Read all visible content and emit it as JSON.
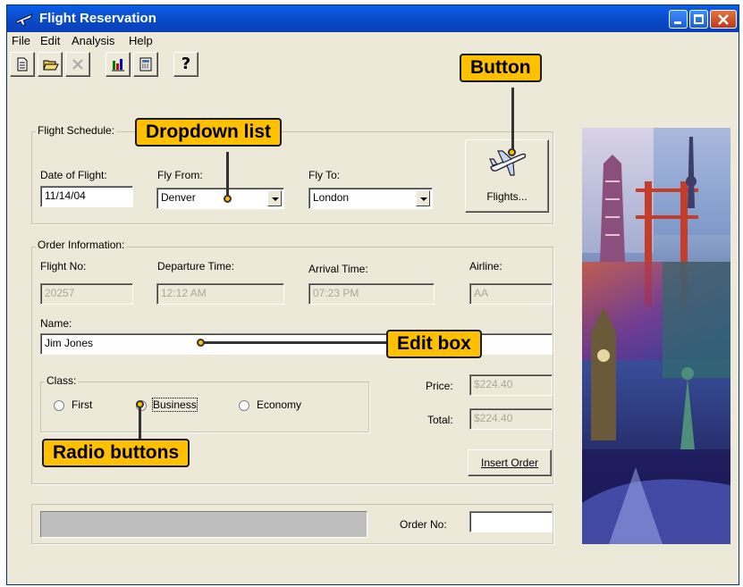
{
  "window": {
    "title": "Flight Reservation"
  },
  "menu": [
    "File",
    "Edit",
    "Analysis",
    "Help"
  ],
  "toolbar": {
    "buttons": [
      {
        "icon": "new-document-icon"
      },
      {
        "icon": "open-folder-icon"
      },
      {
        "icon": "delete-x-icon"
      },
      {
        "icon": "bar-chart-icon"
      },
      {
        "icon": "calculator-icon"
      },
      {
        "icon": "help-question-icon",
        "label": "?"
      }
    ]
  },
  "schedule": {
    "group_label": "Flight Schedule:",
    "date_label": "Date of Flight:",
    "date_value": "11/14/04",
    "from_label": "Fly From:",
    "from_value": "Denver",
    "to_label": "Fly To:",
    "to_value": "London",
    "flights_button": "Flights..."
  },
  "order": {
    "group_label": "Order Information:",
    "flight_no_label": "Flight No:",
    "flight_no_value": "20257",
    "departure_label": "Departure Time:",
    "departure_value": "12:12 AM",
    "arrival_label": "Arrival Time:",
    "arrival_value": "07:23 PM",
    "airline_label": "Airline:",
    "airline_value": "AA",
    "name_label": "Name:",
    "name_value": "Jim Jones",
    "class_label": "Class:",
    "class_options": [
      "First",
      "Business",
      "Economy"
    ],
    "class_selected": "Business",
    "price_label": "Price:",
    "price_value": "$224.40",
    "total_label": "Total:",
    "total_value": "$224.40",
    "insert_button": "Insert Order"
  },
  "footer": {
    "order_no_label": "Order No:",
    "order_no_value": ""
  },
  "callouts": {
    "button": "Button",
    "dropdown": "Dropdown list",
    "editbox": "Edit box",
    "radio": "Radio buttons"
  },
  "colors": {
    "titlebar": "#0a4fd0",
    "callout": "#ffc000",
    "window_bg": "#ece9d8"
  }
}
